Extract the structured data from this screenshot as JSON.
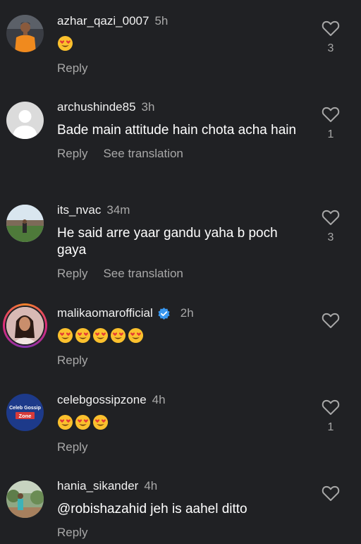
{
  "colors": {
    "background": "#202124",
    "secondary_text": "#a8a8a8",
    "verified_blue": "#3897f0"
  },
  "comments": [
    {
      "username": "azhar_qazi_0007",
      "time": "5h",
      "emoji_count": 1,
      "like_count": "3",
      "reply_label": "Reply",
      "avatar_icon": "man-orange-shirt-avatar"
    },
    {
      "username": "archushinde85",
      "time": "3h",
      "text": "Bade main attitude hain chota acha hain",
      "like_count": "1",
      "reply_label": "Reply",
      "translate_label": "See translation",
      "avatar_icon": "default-user-avatar"
    },
    {
      "username": "its_nvac",
      "time": "34m",
      "text": "He said arre yaar gandu yaha b poch gaya",
      "like_count": "3",
      "reply_label": "Reply",
      "translate_label": "See translation",
      "avatar_icon": "stadium-photo-avatar"
    },
    {
      "username": "malikaomarofficial",
      "time": "2h",
      "emoji_count": 5,
      "like_count": "",
      "reply_label": "Reply",
      "avatar_icon": "woman-story-avatar"
    },
    {
      "username": "celebgossipzone",
      "time": "4h",
      "emoji_count": 3,
      "like_count": "1",
      "reply_label": "Reply",
      "avatar_text_top": "Celeb Gossip",
      "avatar_text_bottom": "Zone",
      "avatar_icon": "celeb-gossip-logo"
    },
    {
      "username": "hania_sikander",
      "time": "4h",
      "text": "@robishazahid jeh is aahel ditto",
      "like_count": "",
      "reply_label": "Reply",
      "avatar_icon": "garden-photo-avatar"
    }
  ]
}
